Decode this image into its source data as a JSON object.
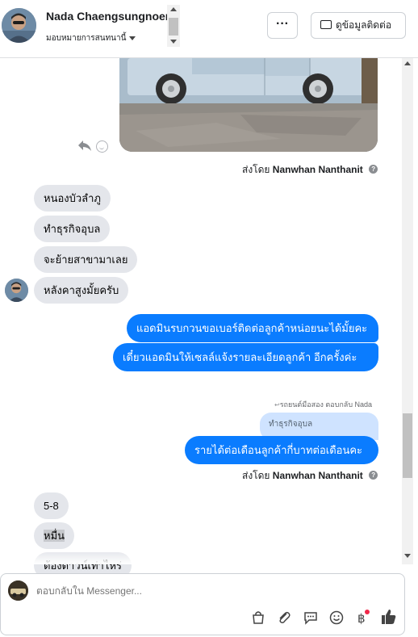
{
  "header": {
    "contact_name": "Nada Chaengsungnoen",
    "assign_label": "มอบหมายการสนทนานี้",
    "more_label": "···",
    "view_contact_label": "ดูข้อมูลติดต่อ"
  },
  "messages": {
    "sent_by_prefix": "ส่งโดย",
    "sent_by_name": "Nanwhan Nanthanit",
    "incoming_1": "หนองบัวลำภู",
    "incoming_2": "ทำธุรกิจอุบล",
    "incoming_3": "จะย้ายสาขามาเลย",
    "incoming_4": "หลังคาสูงมั้ยครับ",
    "outgoing_1": "แอดมินรบกวนขอเบอร์ติดต่อลูกค้าหน่อยนะได้มั้ยคะ",
    "outgoing_2": "เดี๋ยวแอดมินให้เซลล์แจ้งรายละเอียดลูกค้า อีกครั้งค่ะ",
    "reply_meta": "รถยนต์มือสอง ตอบกลับ Nada",
    "quoted_text": "ทำธุรกิจอุบล",
    "outgoing_3": "รายได้ต่อเดือนลูกค้ากี่บาทต่อเดือนคะ",
    "incoming_5": "5-8",
    "incoming_6": "หมื่น",
    "incoming_7": "ต้องดาวน์เท่าไหร่"
  },
  "composer": {
    "placeholder": "ตอบกลับใน Messenger..."
  },
  "icons": {
    "reply": "reply-icon",
    "reaction": "smile-icon",
    "info": "info-icon",
    "bag": "shopping-bag-icon",
    "attach": "paperclip-icon",
    "saved_replies": "chat-bubble-icon",
    "emoji": "emoji-icon",
    "payment": "baht-icon",
    "like": "thumbs-up-icon"
  },
  "colors": {
    "outgoing_bubble": "#0a7cff",
    "incoming_bubble": "#e4e6eb",
    "quoted_bubble": "#cfe3ff",
    "notification_dot": "#f02849"
  }
}
